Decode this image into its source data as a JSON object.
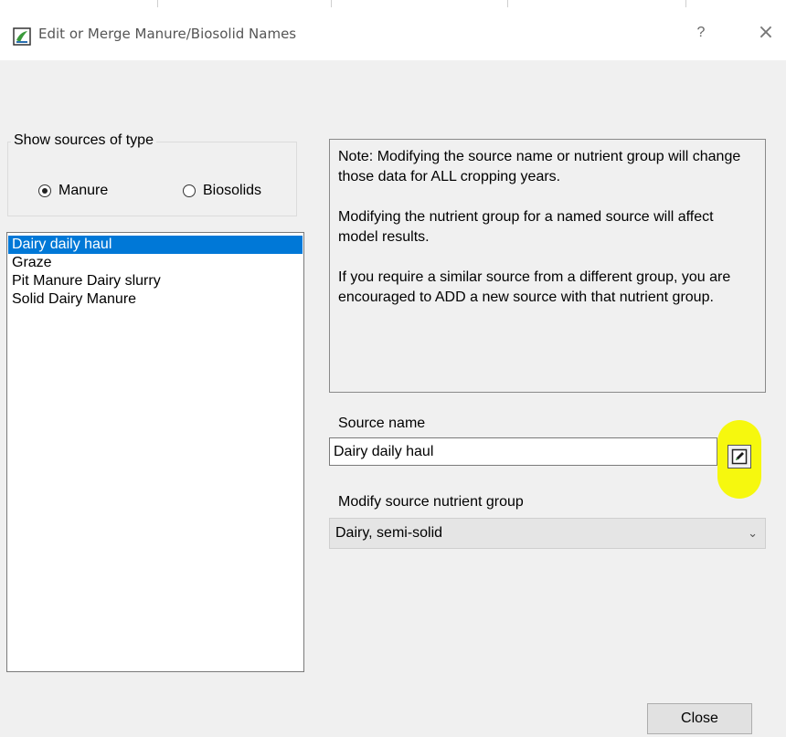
{
  "window": {
    "title": "Edit or Merge Manure/Biosolid Names",
    "help_glyph": "?",
    "close_glyph": "×"
  },
  "source_type": {
    "label": "Show sources of type",
    "options": [
      {
        "label": "Manure",
        "checked": true
      },
      {
        "label": "Biosolids",
        "checked": false
      }
    ]
  },
  "sources": {
    "items": [
      {
        "label": "Dairy daily haul",
        "selected": true
      },
      {
        "label": "Graze",
        "selected": false
      },
      {
        "label": "Pit Manure Dairy slurry",
        "selected": false
      },
      {
        "label": "Solid Dairy Manure",
        "selected": false
      }
    ]
  },
  "note": {
    "paragraphs": [
      "Note: Modifying the source name or nutrient group will change those data for ALL cropping years.",
      "Modifying the nutrient group for a named source will affect model results.",
      "If you require a similar source from a different group, you are encouraged to ADD a new source with that nutrient group."
    ]
  },
  "source_name": {
    "label": "Source name",
    "value": "Dairy daily haul"
  },
  "nutrient_group": {
    "label": "Modify source nutrient group",
    "value": "Dairy, semi-solid"
  },
  "footer": {
    "close_label": "Close"
  },
  "colors": {
    "selection": "#0078d7",
    "highlight": "#f6f80e"
  }
}
